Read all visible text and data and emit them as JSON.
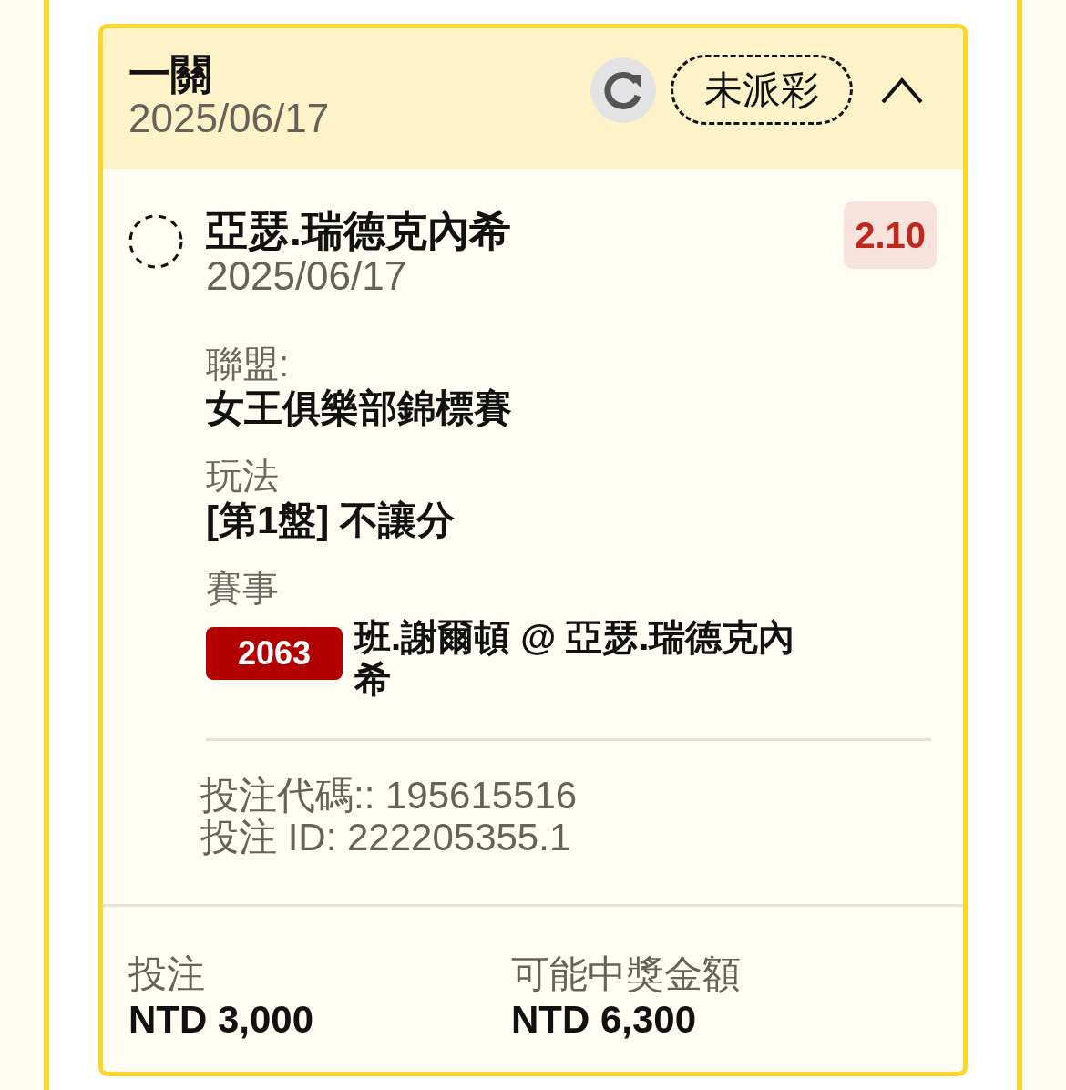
{
  "header": {
    "title": "一關",
    "date": "2025/06/17",
    "status": "未派彩",
    "expanded": true
  },
  "selection": {
    "name": "亞瑟.瑞德克內希",
    "date": "2025/06/17",
    "odds": "2.10"
  },
  "details": [
    {
      "kind": "text",
      "label": "聯盟:",
      "value": "女王俱樂部錦標賽"
    },
    {
      "kind": "text",
      "label": "玩法",
      "value": "[第1盤] 不讓分"
    },
    {
      "kind": "event",
      "label": "賽事",
      "event_code": "2063",
      "value": "班.謝爾頓 @ 亞瑟.瑞德克內希"
    }
  ],
  "references": [
    "投注代碼:: 195615516",
    "投注 ID: 222205355.1"
  ],
  "summary": [
    {
      "label": "投注",
      "amount": "NTD 3,000"
    },
    {
      "label": "可能中獎金額",
      "amount": "NTD 6,300"
    }
  ]
}
